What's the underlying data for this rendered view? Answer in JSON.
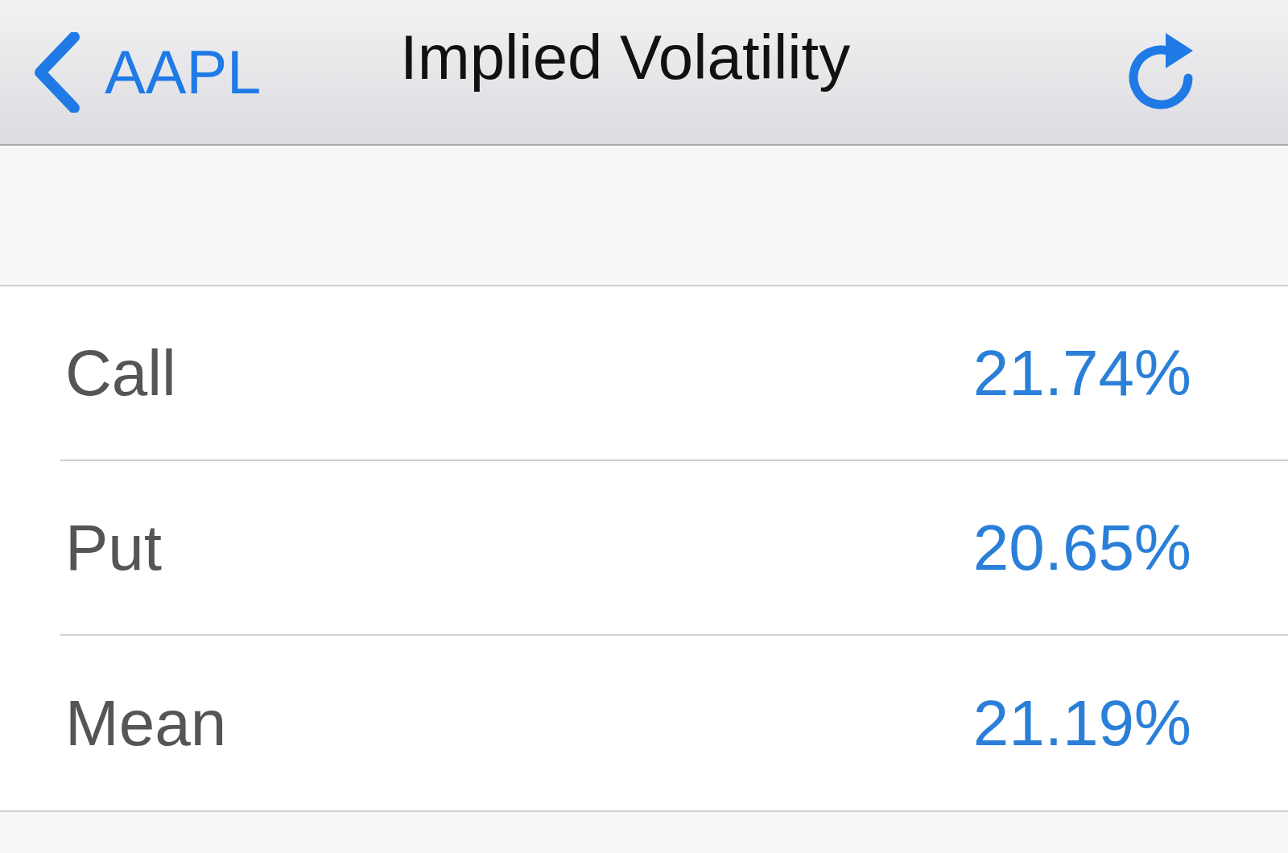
{
  "nav_bar": {
    "back_label": "AAPL",
    "title": "Implied Volatility"
  },
  "rows": [
    {
      "label": "Call",
      "value": "21.74%"
    },
    {
      "label": "Put",
      "value": "20.65%"
    },
    {
      "label": "Mean",
      "value": "21.19%"
    }
  ]
}
